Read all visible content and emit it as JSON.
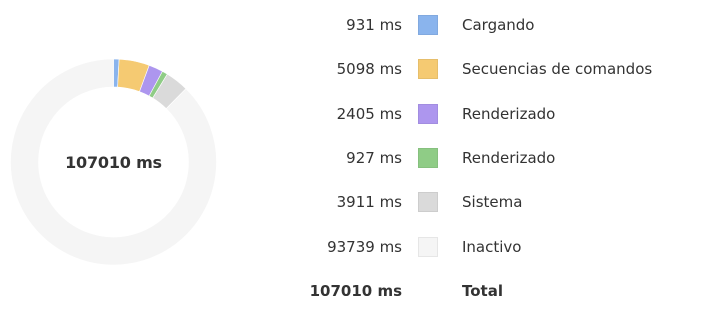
{
  "total_label": "107010 ms",
  "legend": [
    {
      "value": 931,
      "value_text": "931 ms",
      "label": "Cargando",
      "color": "#8ab4ed"
    },
    {
      "value": 5098,
      "value_text": "5098 ms",
      "label": "Secuencias de comandos",
      "color": "#f5ca72"
    },
    {
      "value": 2405,
      "value_text": "2405 ms",
      "label": "Renderizado",
      "color": "#ad96ee"
    },
    {
      "value": 927,
      "value_text": "927 ms",
      "label": "Renderizado",
      "color": "#8fcc86"
    },
    {
      "value": 3911,
      "value_text": "3911 ms",
      "label": "Sistema",
      "color": "#dadada"
    },
    {
      "value": 93739,
      "value_text": "93739 ms",
      "label": "Inactivo",
      "color": "#f5f5f5"
    }
  ],
  "total_row": {
    "value_text": "107010 ms",
    "label": "Total"
  }
}
